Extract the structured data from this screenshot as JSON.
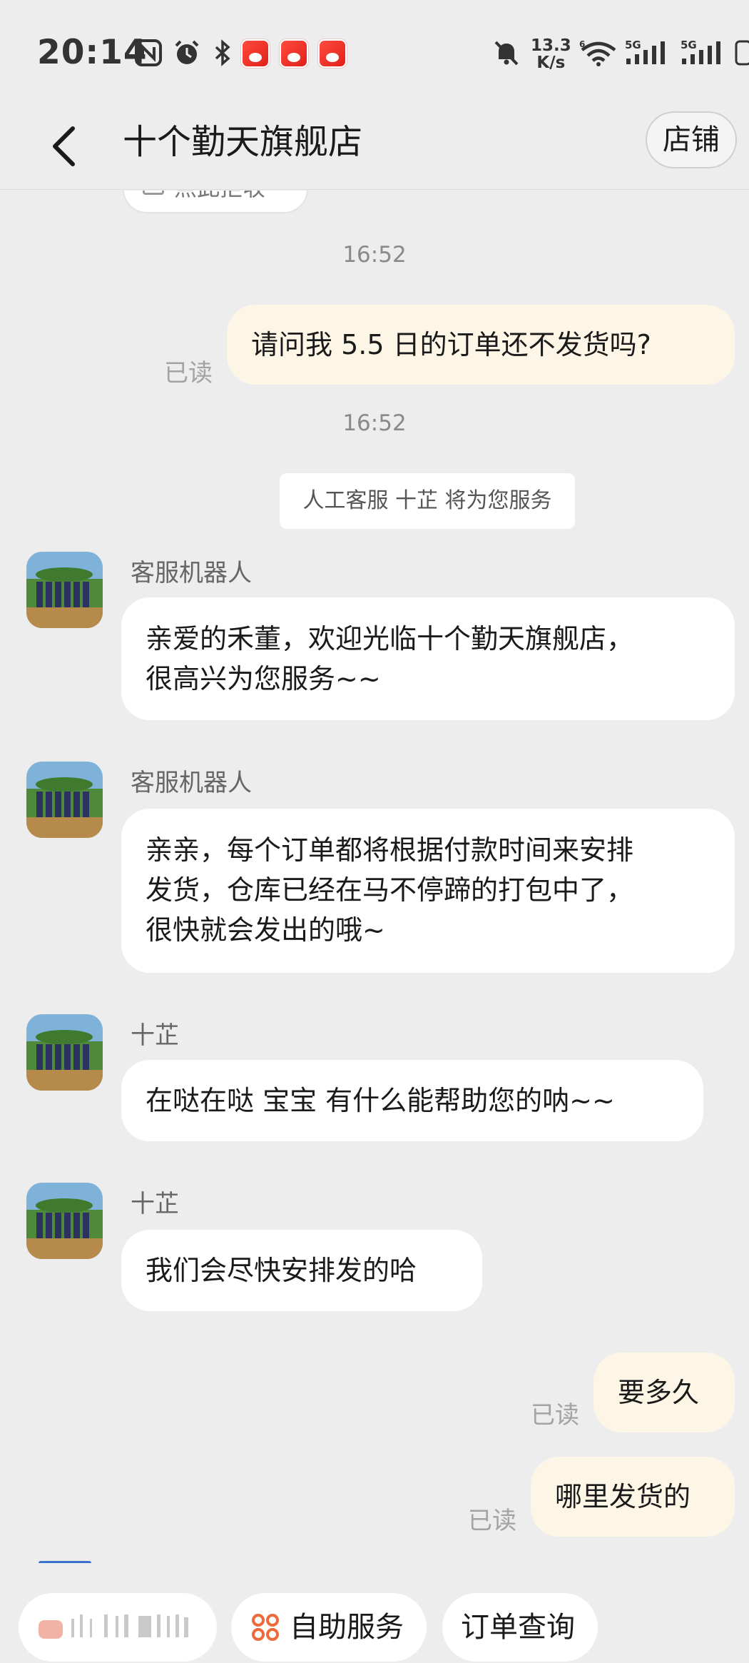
{
  "status_bar": {
    "time": "20:14",
    "net_speed_value": "13.3",
    "net_speed_unit": "K/s",
    "sim1": "5G",
    "sim2": "5G"
  },
  "header": {
    "title": "十个勤天旗舰店",
    "shop_button": "店铺"
  },
  "chat": {
    "partial_pill": "点此拒收",
    "messages": [
      {
        "type": "timestamp",
        "text": "16:52"
      },
      {
        "type": "outgoing",
        "text": "请问我 5.5 日的订单还不发货吗?",
        "read": "已读"
      },
      {
        "type": "timestamp",
        "text": "16:52"
      },
      {
        "type": "system",
        "text": "人工客服 十芷 将为您服务"
      },
      {
        "type": "incoming",
        "sender": "客服机器人",
        "lines": [
          "亲爱的禾董，欢迎光临十个勤天旗舰店，",
          "很高兴为您服务~~"
        ]
      },
      {
        "type": "incoming",
        "sender": "客服机器人",
        "lines": [
          "亲亲，每个订单都将根据付款时间来安排",
          "发货，仓库已经在马不停蹄的打包中了，",
          "很快就会发出的哦~"
        ]
      },
      {
        "type": "incoming",
        "sender": "十芷",
        "lines": [
          "在哒在哒 宝宝  有什么能帮助您的呐~~"
        ]
      },
      {
        "type": "incoming",
        "sender": "十芷",
        "lines": [
          "我们会尽快安排发的哈"
        ]
      },
      {
        "type": "outgoing",
        "text": "要多久",
        "read": "已读"
      },
      {
        "type": "outgoing",
        "text": "哪里发货的",
        "read": "已读"
      }
    ]
  },
  "bottom_bar": {
    "chips": [
      {
        "label": ""
      },
      {
        "label": "自助服务"
      },
      {
        "label": "订单查询"
      }
    ]
  },
  "colors": {
    "background": "#ededed",
    "outgoing_bubble": "#fdf6e6",
    "incoming_bubble": "#ffffff",
    "accent_orange": "#ef6a3a"
  }
}
